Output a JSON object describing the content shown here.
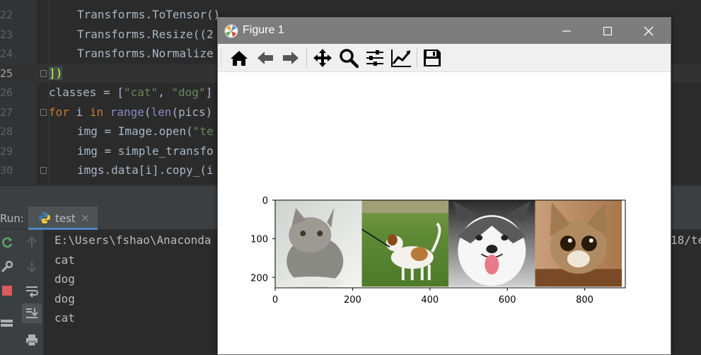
{
  "editor": {
    "lines": [
      {
        "num": "22",
        "text": "Transforms.ToTensor()"
      },
      {
        "num": "23",
        "text": "Transforms.Resize((2"
      },
      {
        "num": "24",
        "text": "Transforms.Normalize"
      },
      {
        "num": "25",
        "text": "])"
      },
      {
        "num": "26",
        "pre": "classes = [",
        "s1": "\"cat\"",
        "mid": ", ",
        "s2": "\"dog\"",
        "post": "]"
      },
      {
        "num": "27",
        "kw1": "for",
        "a": " i ",
        "kw2": "in",
        "b": " ",
        "fn1": "range",
        "c": "(",
        "fn2": "len",
        "d": "(pics)"
      },
      {
        "num": "28",
        "pre": "img = Image.open(",
        "s1": "\"te"
      },
      {
        "num": "29",
        "text": "img = simple_transfo"
      },
      {
        "num": "30",
        "text": "imgs.data[i].copy_(i"
      }
    ]
  },
  "run_panel": {
    "label": "Run:",
    "tab_label": "test",
    "tab_close": "×",
    "console": {
      "path_start": "E:\\Users\\fshao\\Anaconda",
      "path_end": "18/te",
      "outputs": [
        "cat",
        "dog",
        "dog",
        "cat"
      ]
    }
  },
  "figure_window": {
    "title": "Figure 1",
    "toolbar_buttons": [
      "home-icon",
      "back-icon",
      "forward-icon",
      "pan-icon",
      "zoom-icon",
      "subplots-icon",
      "edit-curves-icon",
      "save-icon"
    ]
  },
  "chart_data": {
    "type": "image",
    "title": "",
    "images": [
      {
        "name": "cat kitten",
        "x_range": [
          0,
          224
        ]
      },
      {
        "name": "dog on leash",
        "x_range": [
          224,
          448
        ]
      },
      {
        "name": "husky puppy",
        "x_range": [
          448,
          672
        ]
      },
      {
        "name": "surprised cat",
        "x_range": [
          672,
          896
        ]
      }
    ],
    "xlim": [
      0,
      905
    ],
    "ylim": [
      0,
      227
    ],
    "x_ticks": [
      0,
      200,
      400,
      600,
      800
    ],
    "y_ticks": [
      0,
      100,
      200
    ]
  },
  "colors": {
    "accent": "#4a88c7",
    "titlebar": "#7d7d7d"
  }
}
